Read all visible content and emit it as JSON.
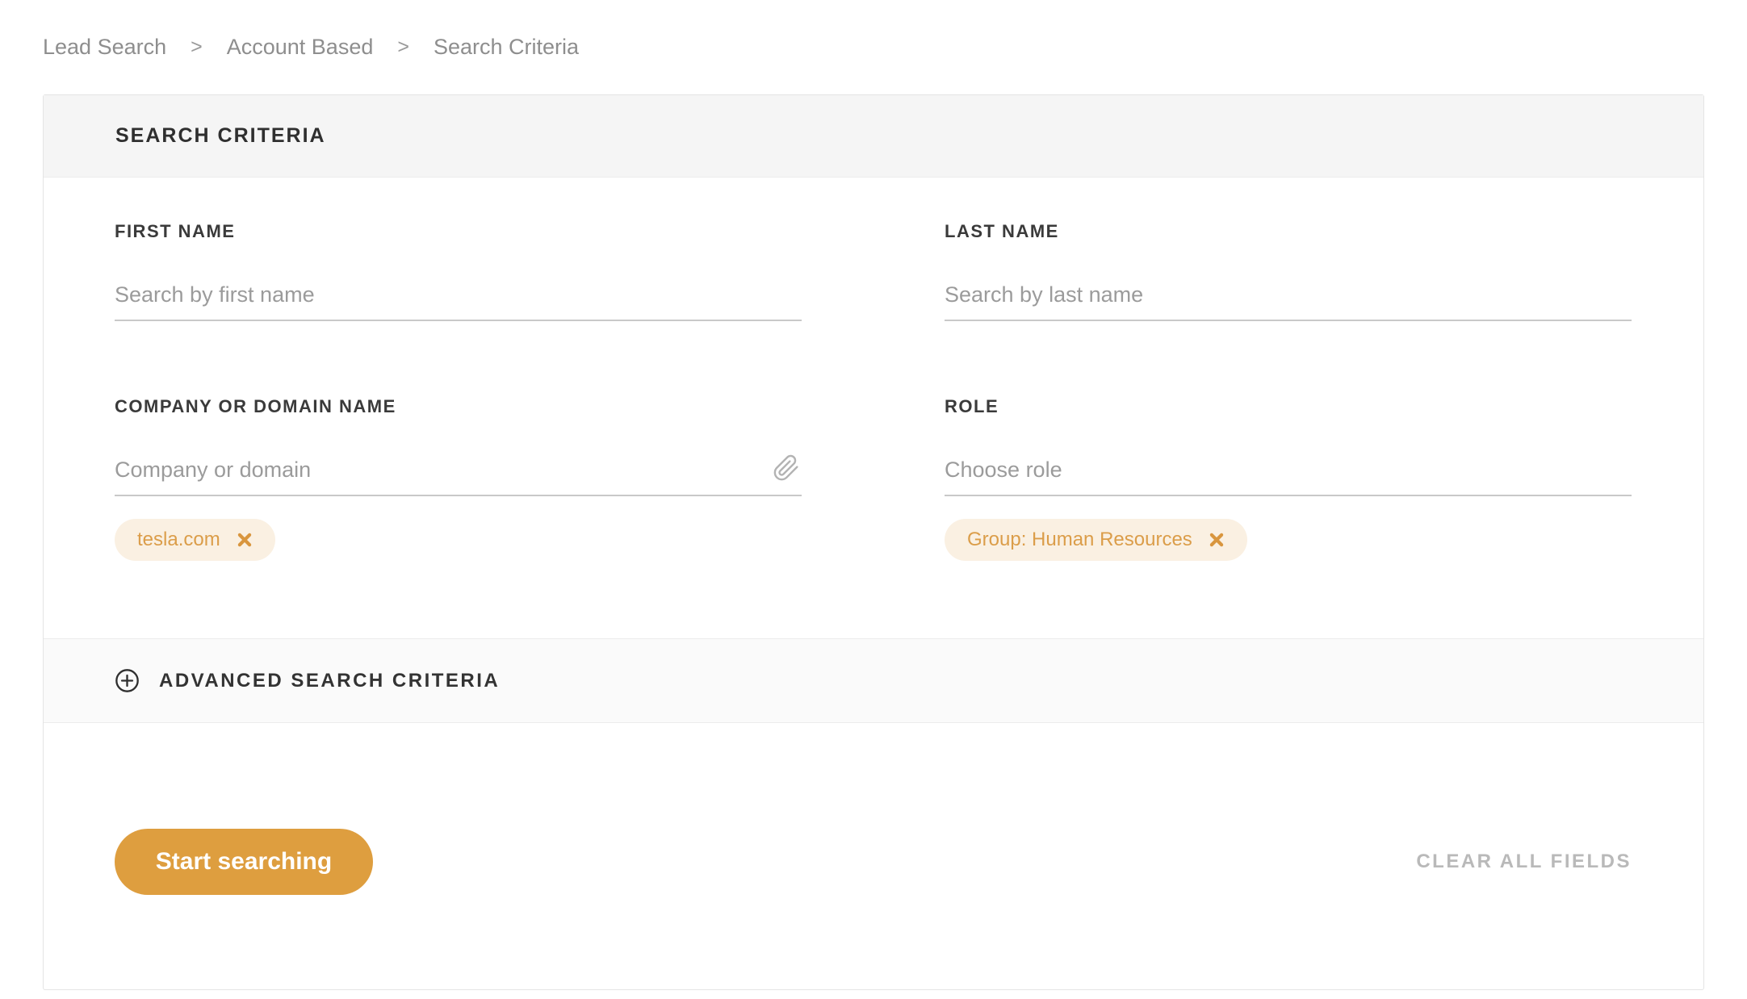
{
  "breadcrumb": {
    "separator": ">",
    "items": [
      "Lead Search",
      "Account Based",
      "Search Criteria"
    ]
  },
  "panel": {
    "title": "SEARCH CRITERIA",
    "fields": {
      "first_name": {
        "label": "FIRST NAME",
        "placeholder": "Search by first name",
        "value": ""
      },
      "last_name": {
        "label": "LAST NAME",
        "placeholder": "Search by last name",
        "value": ""
      },
      "company": {
        "label": "COMPANY OR DOMAIN NAME",
        "placeholder": "Company or domain",
        "value": "",
        "icon": "paperclip-icon",
        "tags": [
          {
            "label": "tesla.com"
          }
        ]
      },
      "role": {
        "label": "ROLE",
        "placeholder": "Choose role",
        "value": "",
        "tags": [
          {
            "label": "Group: Human Resources"
          }
        ]
      }
    },
    "advanced": {
      "label": "ADVANCED SEARCH CRITERIA",
      "icon": "plus-circle-icon"
    },
    "actions": {
      "start_button": "Start searching",
      "clear_all": "CLEAR ALL FIELDS"
    }
  },
  "colors": {
    "accent_orange": "#de9e3f",
    "tag_background": "#faf0e2",
    "tag_text": "#db9d49",
    "breadcrumb_gray": "#8e8e8e",
    "header_background": "#f5f5f5",
    "underline_gray": "#c9c9c9"
  }
}
